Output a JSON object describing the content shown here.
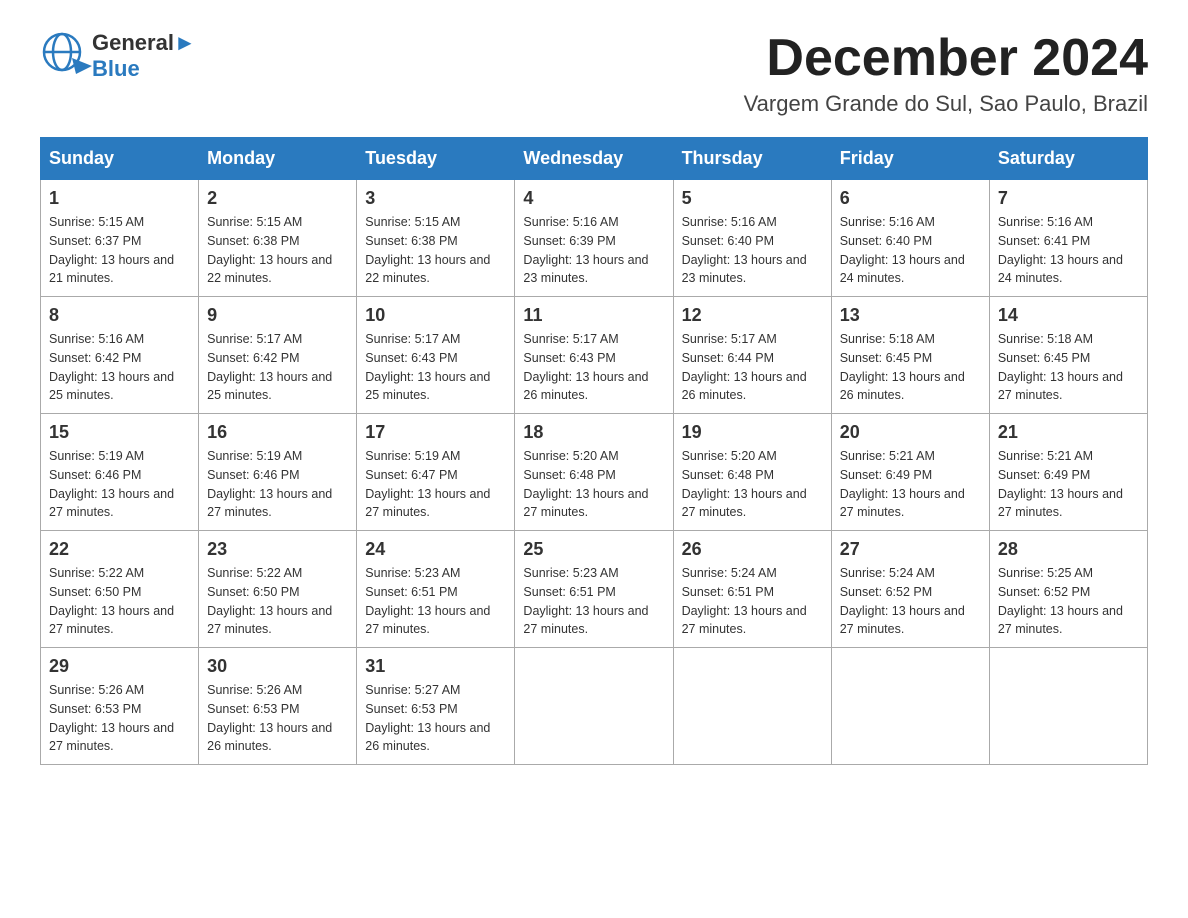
{
  "header": {
    "logo_line1": "General",
    "logo_line2": "Blue",
    "month_title": "December 2024",
    "location": "Vargem Grande do Sul, Sao Paulo, Brazil"
  },
  "weekdays": [
    "Sunday",
    "Monday",
    "Tuesday",
    "Wednesday",
    "Thursday",
    "Friday",
    "Saturday"
  ],
  "weeks": [
    [
      {
        "day": "1",
        "sunrise": "5:15 AM",
        "sunset": "6:37 PM",
        "daylight": "13 hours and 21 minutes."
      },
      {
        "day": "2",
        "sunrise": "5:15 AM",
        "sunset": "6:38 PM",
        "daylight": "13 hours and 22 minutes."
      },
      {
        "day": "3",
        "sunrise": "5:15 AM",
        "sunset": "6:38 PM",
        "daylight": "13 hours and 22 minutes."
      },
      {
        "day": "4",
        "sunrise": "5:16 AM",
        "sunset": "6:39 PM",
        "daylight": "13 hours and 23 minutes."
      },
      {
        "day": "5",
        "sunrise": "5:16 AM",
        "sunset": "6:40 PM",
        "daylight": "13 hours and 23 minutes."
      },
      {
        "day": "6",
        "sunrise": "5:16 AM",
        "sunset": "6:40 PM",
        "daylight": "13 hours and 24 minutes."
      },
      {
        "day": "7",
        "sunrise": "5:16 AM",
        "sunset": "6:41 PM",
        "daylight": "13 hours and 24 minutes."
      }
    ],
    [
      {
        "day": "8",
        "sunrise": "5:16 AM",
        "sunset": "6:42 PM",
        "daylight": "13 hours and 25 minutes."
      },
      {
        "day": "9",
        "sunrise": "5:17 AM",
        "sunset": "6:42 PM",
        "daylight": "13 hours and 25 minutes."
      },
      {
        "day": "10",
        "sunrise": "5:17 AM",
        "sunset": "6:43 PM",
        "daylight": "13 hours and 25 minutes."
      },
      {
        "day": "11",
        "sunrise": "5:17 AM",
        "sunset": "6:43 PM",
        "daylight": "13 hours and 26 minutes."
      },
      {
        "day": "12",
        "sunrise": "5:17 AM",
        "sunset": "6:44 PM",
        "daylight": "13 hours and 26 minutes."
      },
      {
        "day": "13",
        "sunrise": "5:18 AM",
        "sunset": "6:45 PM",
        "daylight": "13 hours and 26 minutes."
      },
      {
        "day": "14",
        "sunrise": "5:18 AM",
        "sunset": "6:45 PM",
        "daylight": "13 hours and 27 minutes."
      }
    ],
    [
      {
        "day": "15",
        "sunrise": "5:19 AM",
        "sunset": "6:46 PM",
        "daylight": "13 hours and 27 minutes."
      },
      {
        "day": "16",
        "sunrise": "5:19 AM",
        "sunset": "6:46 PM",
        "daylight": "13 hours and 27 minutes."
      },
      {
        "day": "17",
        "sunrise": "5:19 AM",
        "sunset": "6:47 PM",
        "daylight": "13 hours and 27 minutes."
      },
      {
        "day": "18",
        "sunrise": "5:20 AM",
        "sunset": "6:48 PM",
        "daylight": "13 hours and 27 minutes."
      },
      {
        "day": "19",
        "sunrise": "5:20 AM",
        "sunset": "6:48 PM",
        "daylight": "13 hours and 27 minutes."
      },
      {
        "day": "20",
        "sunrise": "5:21 AM",
        "sunset": "6:49 PM",
        "daylight": "13 hours and 27 minutes."
      },
      {
        "day": "21",
        "sunrise": "5:21 AM",
        "sunset": "6:49 PM",
        "daylight": "13 hours and 27 minutes."
      }
    ],
    [
      {
        "day": "22",
        "sunrise": "5:22 AM",
        "sunset": "6:50 PM",
        "daylight": "13 hours and 27 minutes."
      },
      {
        "day": "23",
        "sunrise": "5:22 AM",
        "sunset": "6:50 PM",
        "daylight": "13 hours and 27 minutes."
      },
      {
        "day": "24",
        "sunrise": "5:23 AM",
        "sunset": "6:51 PM",
        "daylight": "13 hours and 27 minutes."
      },
      {
        "day": "25",
        "sunrise": "5:23 AM",
        "sunset": "6:51 PM",
        "daylight": "13 hours and 27 minutes."
      },
      {
        "day": "26",
        "sunrise": "5:24 AM",
        "sunset": "6:51 PM",
        "daylight": "13 hours and 27 minutes."
      },
      {
        "day": "27",
        "sunrise": "5:24 AM",
        "sunset": "6:52 PM",
        "daylight": "13 hours and 27 minutes."
      },
      {
        "day": "28",
        "sunrise": "5:25 AM",
        "sunset": "6:52 PM",
        "daylight": "13 hours and 27 minutes."
      }
    ],
    [
      {
        "day": "29",
        "sunrise": "5:26 AM",
        "sunset": "6:53 PM",
        "daylight": "13 hours and 27 minutes."
      },
      {
        "day": "30",
        "sunrise": "5:26 AM",
        "sunset": "6:53 PM",
        "daylight": "13 hours and 26 minutes."
      },
      {
        "day": "31",
        "sunrise": "5:27 AM",
        "sunset": "6:53 PM",
        "daylight": "13 hours and 26 minutes."
      },
      null,
      null,
      null,
      null
    ]
  ]
}
